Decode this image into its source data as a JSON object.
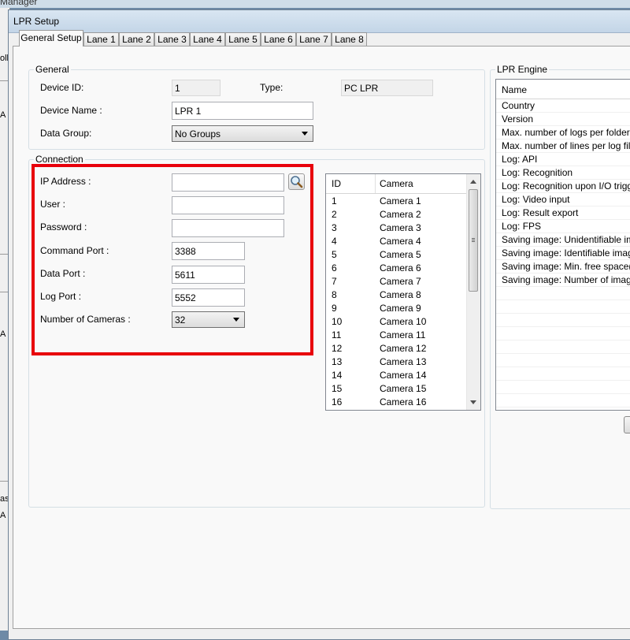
{
  "background_app": {
    "title_fragment": "Manager",
    "side_fragments": [
      "oll",
      "A",
      "A",
      "as",
      "A"
    ]
  },
  "window": {
    "title": "LPR Setup"
  },
  "tabs": [
    "General Setup",
    "Lane 1",
    "Lane 2",
    "Lane 3",
    "Lane 4",
    "Lane 5",
    "Lane 6",
    "Lane 7",
    "Lane 8"
  ],
  "general": {
    "title": "General",
    "device_id_label": "Device ID:",
    "device_id_value": "1",
    "type_label": "Type:",
    "type_value": "PC LPR",
    "device_name_label": "Device Name :",
    "device_name_value": "LPR 1",
    "data_group_label": "Data Group:",
    "data_group_value": "No Groups"
  },
  "connection": {
    "title": "Connection",
    "ip_label": "IP Address :",
    "ip_value": "",
    "user_label": "User :",
    "user_value": "",
    "password_label": "Password :",
    "password_value": "",
    "command_port_label": "Command Port :",
    "command_port_value": "3388",
    "data_port_label": "Data Port :",
    "data_port_value": "5611",
    "log_port_label": "Log Port :",
    "log_port_value": "5552",
    "num_cameras_label": "Number of Cameras :",
    "num_cameras_value": "32",
    "highlight_color": "#e8000b"
  },
  "camera_list": {
    "columns": [
      "ID",
      "Camera"
    ],
    "rows": [
      [
        "1",
        "Camera 1"
      ],
      [
        "2",
        "Camera 2"
      ],
      [
        "3",
        "Camera 3"
      ],
      [
        "4",
        "Camera 4"
      ],
      [
        "5",
        "Camera 5"
      ],
      [
        "6",
        "Camera 6"
      ],
      [
        "7",
        "Camera 7"
      ],
      [
        "8",
        "Camera 8"
      ],
      [
        "9",
        "Camera 9"
      ],
      [
        "10",
        "Camera 10"
      ],
      [
        "11",
        "Camera 11"
      ],
      [
        "12",
        "Camera 12"
      ],
      [
        "13",
        "Camera 13"
      ],
      [
        "14",
        "Camera 14"
      ],
      [
        "15",
        "Camera 15"
      ],
      [
        "16",
        "Camera 16"
      ]
    ]
  },
  "lpr_engine": {
    "title": "LPR Engine",
    "column": "Name",
    "rows": [
      "Country",
      "Version",
      "Max. number of logs per folder",
      "Max. number of lines per log file",
      "Log: API",
      "Log: Recognition",
      "Log: Recognition upon I/O trigger",
      "Log: Video input",
      "Log: Result export",
      "Log: FPS",
      "Saving image: Unidentifiable image",
      "Saving image: Identifiable image",
      "Saving image: Min. free space(MB)",
      "Saving image: Number of images ..."
    ]
  }
}
